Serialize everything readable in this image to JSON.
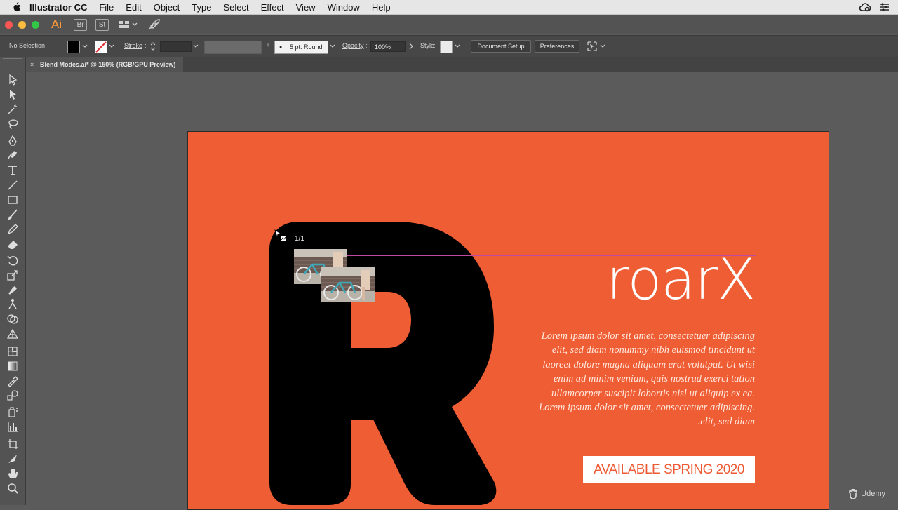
{
  "menubar": {
    "app_name": "Illustrator CC",
    "items": [
      "File",
      "Edit",
      "Object",
      "Type",
      "Select",
      "Effect",
      "View",
      "Window",
      "Help"
    ]
  },
  "appbar": {
    "logo": "Ai",
    "bridge": "Br",
    "stock": "St"
  },
  "control": {
    "selection": "No Selection",
    "stroke_label": "Stroke",
    "brush_value": "5 pt. Round",
    "opacity_label": "Opacity",
    "opacity_value": "100%",
    "style_label": "Style",
    "document_setup": "Document Setup",
    "preferences": "Preferences"
  },
  "tab": {
    "close": "×",
    "title": "Blend Modes.ai* @ 150% (RGB/GPU Preview)"
  },
  "tools": [
    "selection-tool",
    "direct-selection-tool",
    "magic-wand-tool",
    "lasso-tool",
    "pen-tool",
    "curvature-tool",
    "type-tool",
    "line-tool",
    "rectangle-tool",
    "paintbrush-tool",
    "pencil-tool",
    "eraser-tool",
    "rotate-tool",
    "scale-tool",
    "warp-tool",
    "puppet-warp-tool",
    "shape-builder-tool",
    "perspective-grid-tool",
    "mesh-tool",
    "gradient-tool",
    "eyedropper-tool",
    "blend-tool",
    "symbol-sprayer-tool",
    "graph-tool",
    "artboard-tool",
    "slice-tool",
    "hand-tool",
    "zoom-tool"
  ],
  "artwork": {
    "brand": "roarX",
    "body": "Lorem ipsum dolor sit amet, consectetuer adipiscing elit, sed diam nonummy nibh euismod tincidunt ut laoreet dolore magna aliquam erat volutpat. Ut wisi enim ad minim veniam, quis nostrud exerci tation ullamcorper suscipit lobortis nisl ut aliquip ex ea. Lorem ipsum dolor sit amet, consectetuer adipiscing. .elit, sed diam",
    "cta": "AVAILABLE SPRING 2020",
    "place_count": "1/1"
  },
  "watermark": "Udemy",
  "colors": {
    "artboard": "#ef5d34",
    "accent_logo": "#ff9a3a"
  }
}
